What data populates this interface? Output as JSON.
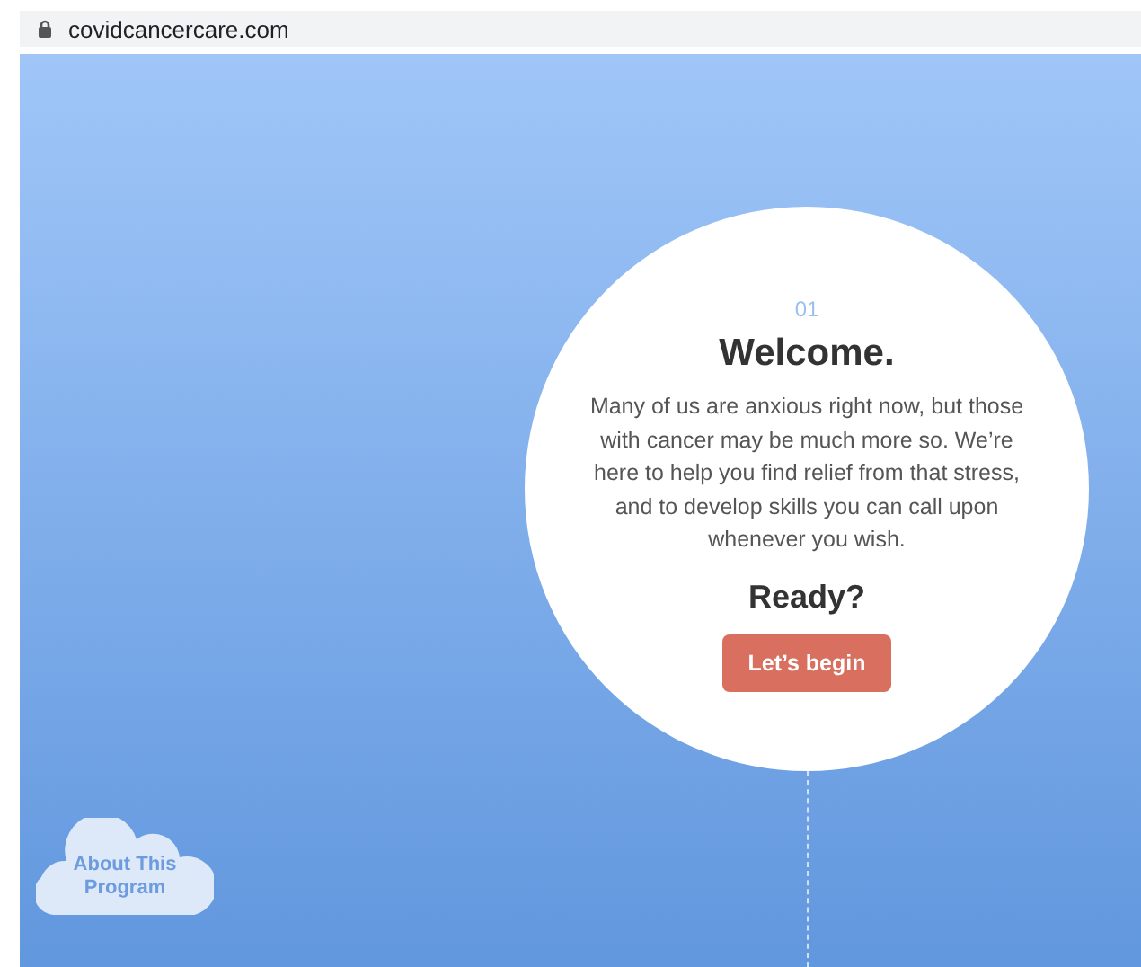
{
  "address_bar": {
    "url": "covidcancercare.com"
  },
  "intro": {
    "step": "01",
    "title": "Welcome.",
    "body": "Many of us are anxious right now, but those with cancer may be much more so. We’re here to help you find relief from that stress, and to develop skills you can call upon whenever you wish.",
    "prompt": "Ready?",
    "button": "Let’s begin"
  },
  "about_button": {
    "label": "About This Program"
  }
}
